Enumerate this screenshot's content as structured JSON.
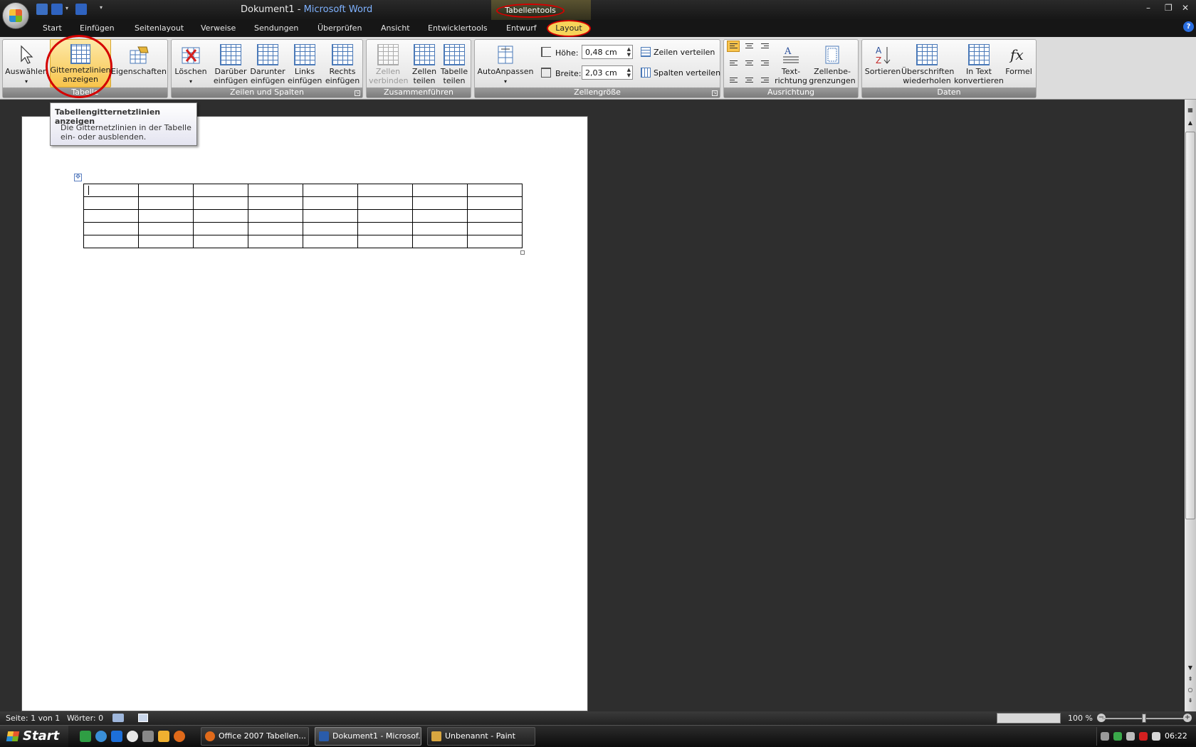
{
  "titlebar": {
    "doc_name": "Dokument1",
    "separator": " - ",
    "app_name": "Microsoft Word",
    "contextual_tab_group": "Tabellentools",
    "window_controls": [
      "minimize-icon",
      "restore-icon",
      "close-icon"
    ],
    "minimize_glyph": "–",
    "restore_glyph": "❐",
    "close_glyph": "✕"
  },
  "tabs": [
    "Start",
    "Einfügen",
    "Seitenlayout",
    "Verweise",
    "Sendungen",
    "Überprüfen",
    "Ansicht",
    "Entwicklertools",
    "Entwurf",
    "Layout"
  ],
  "active_tab": "Layout",
  "ribbon": {
    "groups": {
      "tabelle": {
        "label": "Tabelle",
        "auswaehlen": "Auswählen",
        "gitter_line1": "Gitternetzlinien",
        "gitter_line2": "anzeigen",
        "eigenschaften": "Eigenschaften"
      },
      "zeilen_spalten": {
        "label": "Zeilen und Spalten",
        "loeschen": "Löschen",
        "darueber_1": "Darüber",
        "darueber_2": "einfügen",
        "darunter_1": "Darunter",
        "darunter_2": "einfügen",
        "links_1": "Links",
        "links_2": "einfügen",
        "rechts_1": "Rechts",
        "rechts_2": "einfügen"
      },
      "zusammenfuehren": {
        "label": "Zusammenführen",
        "zellen_verbinden_1": "Zellen",
        "zellen_verbinden_2": "verbinden",
        "zellen_teilen_1": "Zellen",
        "zellen_teilen_2": "teilen",
        "tabelle_teilen_1": "Tabelle",
        "tabelle_teilen_2": "teilen"
      },
      "zellengroesse": {
        "label": "Zellengröße",
        "autoanpassen": "AutoAnpassen",
        "hoehe_label": "Höhe:",
        "hoehe_value": "0,48 cm",
        "breite_label": "Breite:",
        "breite_value": "2,03 cm",
        "zeilen_verteilen": "Zeilen verteilen",
        "spalten_verteilen": "Spalten verteilen"
      },
      "ausrichtung": {
        "label": "Ausrichtung",
        "textrichtung_1": "Text-",
        "textrichtung_2": "richtung",
        "zellenbegrenzungen_1": "Zellenbe-",
        "zellenbegrenzungen_2": "grenzungen"
      },
      "daten": {
        "label": "Daten",
        "sortieren": "Sortieren",
        "ueberschriften_1": "Überschriften",
        "ueberschriften_2": "wiederholen",
        "in_text_1": "In Text",
        "in_text_2": "konvertieren",
        "formel": "Formel"
      }
    }
  },
  "tooltip": {
    "title": "Tabellengitternetzlinien anzeigen",
    "body": "Die Gitternetzlinien in der Tabelle ein- oder ausblenden."
  },
  "document": {
    "table_rows": 5,
    "table_cols": 8
  },
  "statusbar": {
    "page": "Seite: 1 von 1",
    "words": "Wörter: 0",
    "zoom": "100 %"
  },
  "taskbar": {
    "start": "Start",
    "items": [
      {
        "label": "Office 2007 Tabellen...",
        "icon": "firefox-icon"
      },
      {
        "label": "Dokument1 - Microsof...",
        "icon": "word-icon"
      },
      {
        "label": "Unbenannt - Paint",
        "icon": "paint-icon"
      }
    ],
    "clock": "06:22"
  },
  "colors": {
    "highlight_ring": "#d40000",
    "active_tab_bg": "#f6d35a",
    "selected_button_bg": "#f8c44c"
  }
}
